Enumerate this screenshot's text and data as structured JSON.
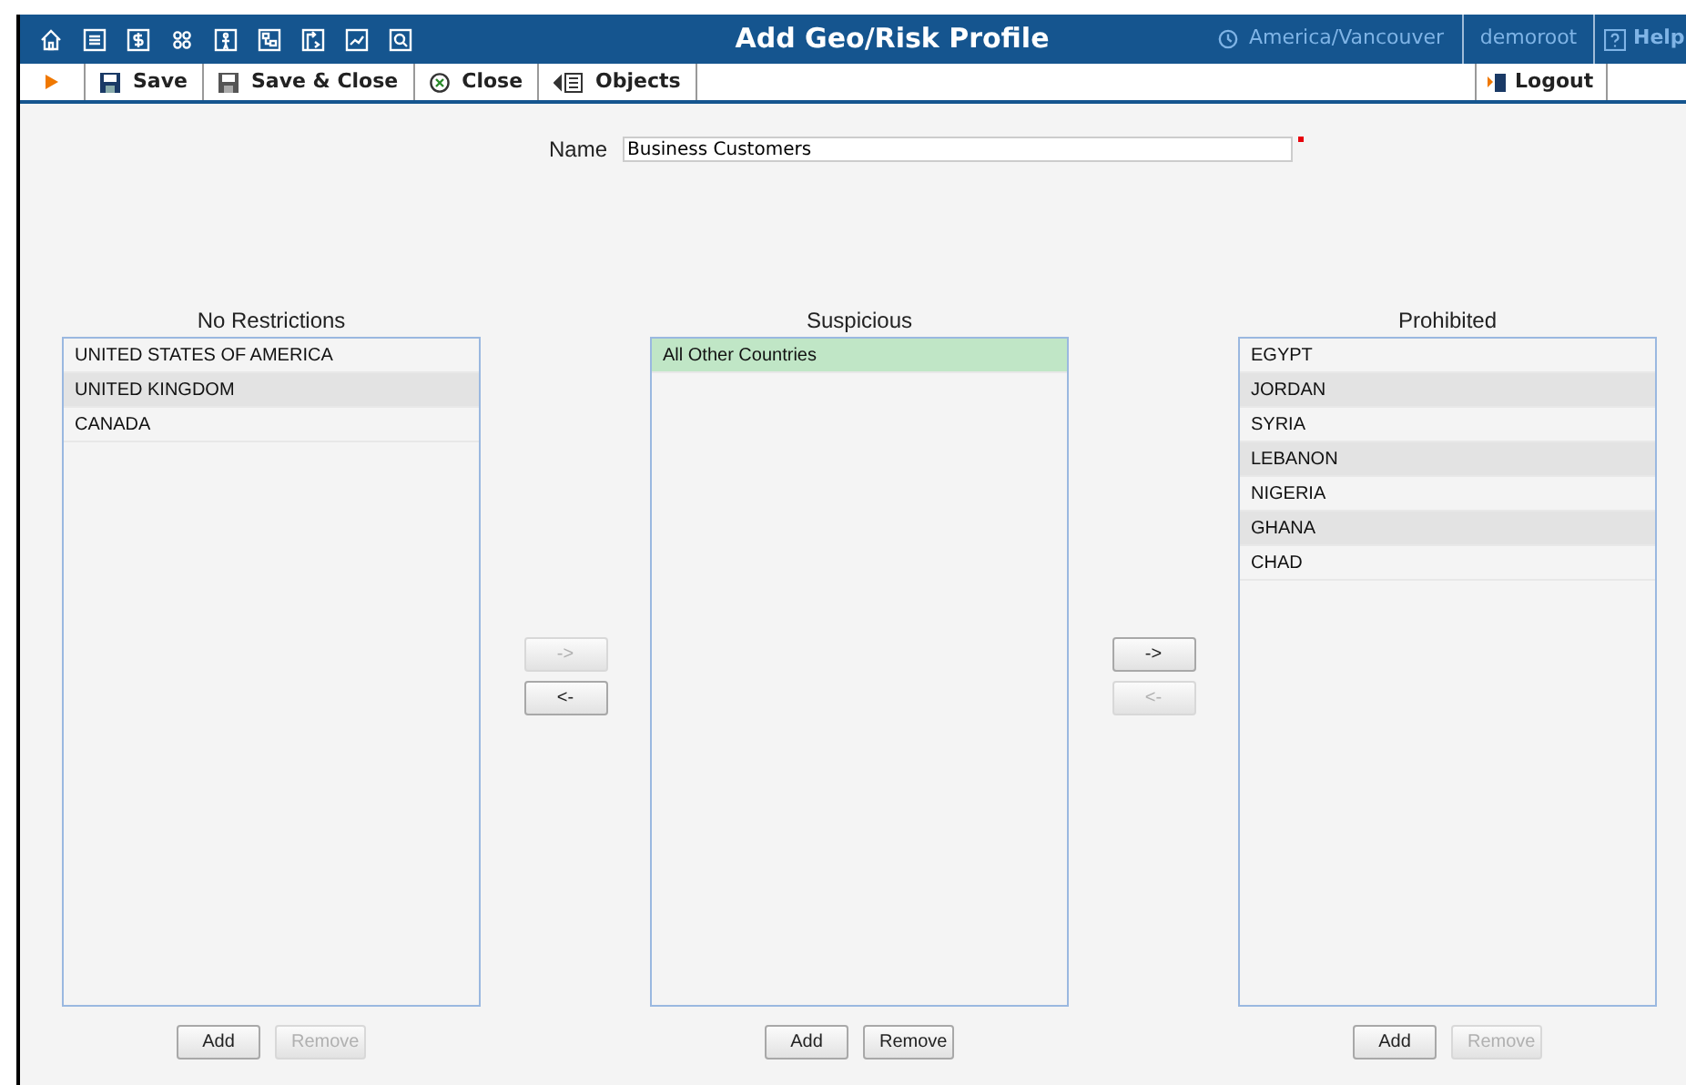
{
  "window": {
    "title": "Add Geo/Risk Profile",
    "timezone": "America/Vancouver",
    "user": "demoroot",
    "help": "Help"
  },
  "toolbar": [
    {
      "kind": "arrow"
    },
    {
      "kind": "save",
      "label": "Save"
    },
    {
      "kind": "save-close",
      "label": "Save & Close"
    },
    {
      "kind": "close",
      "label": "Close"
    },
    {
      "kind": "objects",
      "label": "Objects"
    }
  ],
  "logout": "Logout",
  "name_field": {
    "label": "Name",
    "value": "Business Customers",
    "required": true
  },
  "columns": [
    {
      "title": "No Restrictions",
      "items": [
        {
          "label": "UNITED STATES OF AMERICA",
          "selected": false
        },
        {
          "label": "UNITED KINGDOM",
          "selected": false
        },
        {
          "label": "CANADA",
          "selected": false
        }
      ],
      "add": {
        "label": "Add",
        "disabled": false
      },
      "remove": {
        "label": "Remove",
        "disabled": true
      }
    },
    {
      "title": "Suspicious",
      "items": [
        {
          "label": "All Other Countries",
          "selected": true
        }
      ],
      "add": {
        "label": "Add",
        "disabled": false
      },
      "remove": {
        "label": "Remove",
        "disabled": false
      }
    },
    {
      "title": "Prohibited",
      "items": [
        {
          "label": "EGYPT",
          "selected": false
        },
        {
          "label": "JORDAN",
          "selected": false
        },
        {
          "label": "SYRIA",
          "selected": false
        },
        {
          "label": "LEBANON",
          "selected": false
        },
        {
          "label": "NIGERIA",
          "selected": false
        },
        {
          "label": "GHANA",
          "selected": false
        },
        {
          "label": "CHAD",
          "selected": false
        }
      ],
      "add": {
        "label": "Add",
        "disabled": false
      },
      "remove": {
        "label": "Remove",
        "disabled": true
      }
    }
  ],
  "movers": [
    {
      "right": {
        "label": "->",
        "disabled": true
      },
      "left": {
        "label": "<-",
        "disabled": false
      }
    },
    {
      "right": {
        "label": "->",
        "disabled": false
      },
      "left": {
        "label": "<-",
        "disabled": true
      }
    }
  ]
}
